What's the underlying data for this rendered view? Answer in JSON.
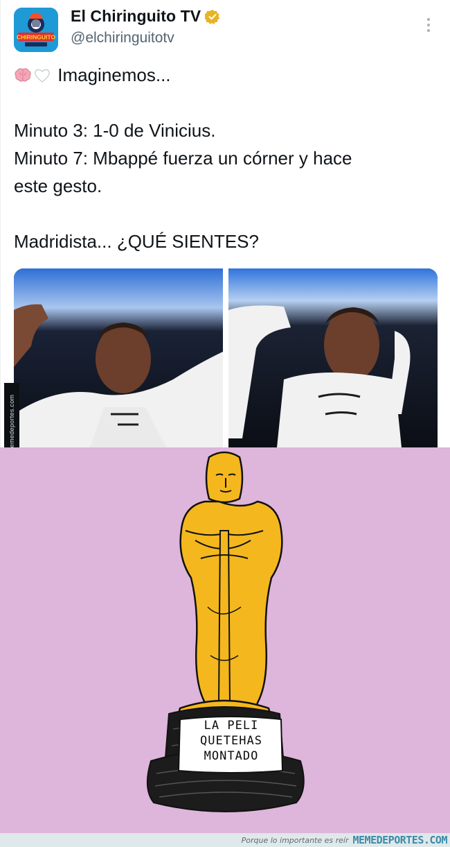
{
  "tweet": {
    "user": {
      "display_name": "El Chiringuito TV",
      "handle": "@elchiringuitotv",
      "verified": true,
      "avatar_text": "CHIRINGUITO"
    },
    "text_lines": [
      "Imaginemos...",
      "",
      "Minuto 3: 1-0 de Vinicius.",
      "Minuto 7: Mbappé fuerza un córner y hace",
      "este gesto.",
      "",
      "Madridista... ¿QUÉ SIENTES?"
    ],
    "emojis": [
      "brain-icon",
      "white-heart-icon"
    ],
    "media": [
      {
        "label": "Photo 1"
      },
      {
        "label": "Photo 2"
      }
    ]
  },
  "watermark_side": "Memedeportes.com",
  "meme": {
    "plaque_lines": [
      "LA PELI",
      "QUETEHAS",
      "MONTADO"
    ],
    "background": "#deb5db",
    "statue_color": "#f4b81e"
  },
  "footer": {
    "tagline": "Porque lo importante es reír",
    "brand": "MEMEDEPORTES.COM"
  },
  "colors": {
    "verified_gold": "#e8b424",
    "handle_gray": "#536471",
    "brand_blue": "#3c8aa8"
  }
}
